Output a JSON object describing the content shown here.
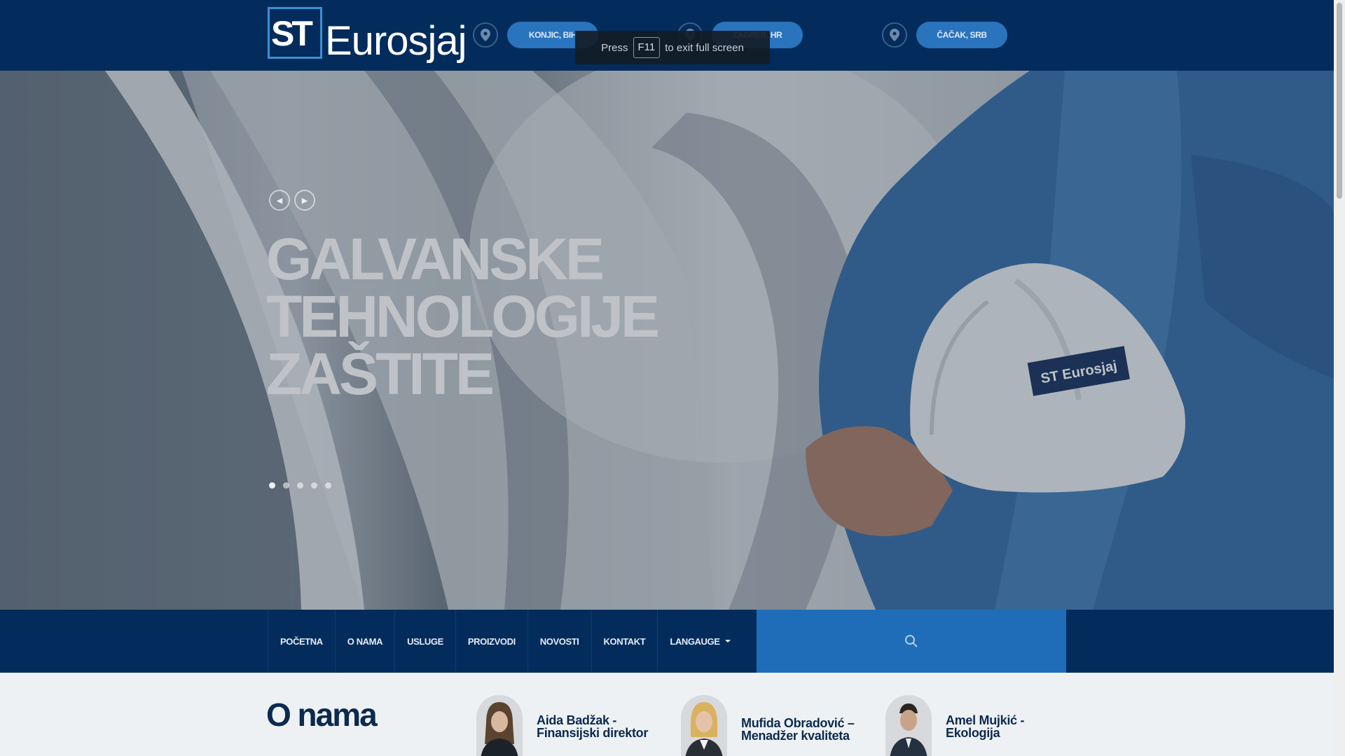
{
  "header": {
    "logo_st": "ST",
    "logo_word": "Eurosjaj",
    "locations": [
      {
        "label": "KONJIC, BIH",
        "icon": "map-pin-icon"
      },
      {
        "label": "ZAGREB, HR",
        "icon": "map-pin-icon"
      },
      {
        "label": "ČAČAK, SRB",
        "icon": "map-pin-icon"
      }
    ]
  },
  "fullscreen_notice": {
    "press": "Press",
    "key": "F11",
    "rest": "to exit full screen"
  },
  "hero": {
    "title_lines": [
      "GALVANSKE",
      "TEHNOLOGIJE",
      "ZAŠTITE"
    ],
    "prev_icon": "chevron-left-icon",
    "next_icon": "chevron-right-icon",
    "slides_total": 5,
    "active_slide": 1,
    "helmet_logo": "ST Eurosjaj"
  },
  "nav": {
    "items": [
      "POČETNA",
      "O NAMA",
      "USLUGE",
      "PROIZVODI",
      "NOVOSTI",
      "KONTAKT",
      "LANGAUGE"
    ],
    "search_placeholder": "",
    "search_icon": "search-icon"
  },
  "about": {
    "title": "O nama",
    "team": [
      {
        "name_line1": "Aida Badžak -",
        "name_line2": "Finansijski direktor"
      },
      {
        "name_line1": "Mufida Obradović –",
        "name_line2": "Menadžer kvaliteta"
      },
      {
        "name_line1": "Amel Mujkić -",
        "name_line2": "Ekologija"
      }
    ]
  },
  "colors": {
    "header_bg": "#032c5c",
    "accent": "#2a73bd",
    "search_bg": "#1f6db8",
    "text_dark": "#0b2a4e"
  }
}
